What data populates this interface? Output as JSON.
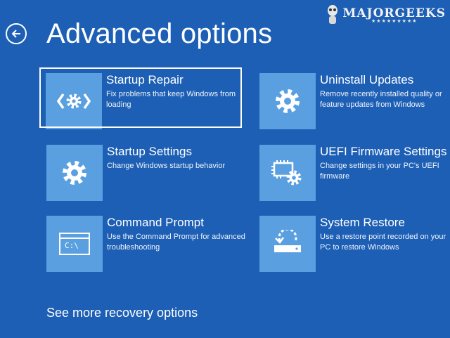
{
  "page": {
    "title": "Advanced options"
  },
  "watermark": {
    "text": "MAJORGEEKS",
    "stars": "★★★★★★★★★"
  },
  "tiles": [
    {
      "title": "Startup Repair",
      "desc": "Fix problems that keep Windows from loading",
      "icon": "code-gear-icon",
      "selected": true
    },
    {
      "title": "Uninstall Updates",
      "desc": "Remove recently installed quality or feature updates from Windows",
      "icon": "gear-icon",
      "selected": false
    },
    {
      "title": "Startup Settings",
      "desc": "Change Windows startup behavior",
      "icon": "gear-icon",
      "selected": false
    },
    {
      "title": "UEFI Firmware Settings",
      "desc": "Change settings in your PC's UEFI firmware",
      "icon": "chip-gear-icon",
      "selected": false
    },
    {
      "title": "Command Prompt",
      "desc": "Use the Command Prompt for advanced troubleshooting",
      "icon": "command-prompt-icon",
      "icon_text": "C:\\",
      "selected": false
    },
    {
      "title": "System Restore",
      "desc": "Use a restore point recorded on your PC to restore Windows",
      "icon": "restore-icon",
      "selected": false
    }
  ],
  "footer": {
    "more_link": "See more recovery options"
  },
  "colors": {
    "background": "#1d5fb5",
    "tile_icon_bg": "#5aa0e0",
    "text": "#ffffff"
  }
}
